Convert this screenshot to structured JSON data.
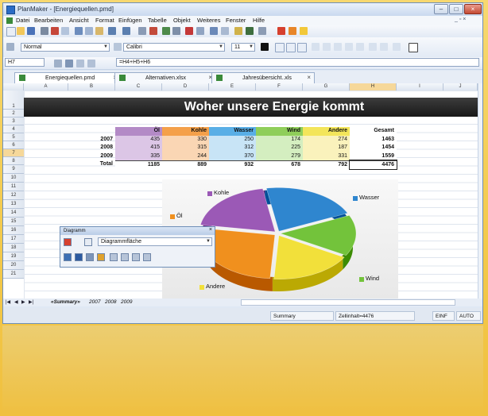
{
  "window": {
    "title": "PlanMaker - [Energiequellen.pmd]",
    "min": "–",
    "max": "□",
    "close": "×"
  },
  "menu": [
    "Datei",
    "Bearbeiten",
    "Ansicht",
    "Format",
    "Einfügen",
    "Tabelle",
    "Objekt",
    "Weiteres",
    "Fenster",
    "Hilfe"
  ],
  "mdi_controls": "_ ▫ ×",
  "format": {
    "style": "Normal",
    "font": "Calibri",
    "size": "11"
  },
  "formula_bar": {
    "cell_ref": "H7",
    "formula": "=H4+H5+H6"
  },
  "tabs": [
    {
      "label": "Energiequellen.pmd",
      "close": "×"
    },
    {
      "label": "Alternativen.xlsx",
      "close": "×"
    },
    {
      "label": "Jahresübersicht..xls",
      "close": "×"
    }
  ],
  "columns": [
    "A",
    "B",
    "C",
    "D",
    "E",
    "F",
    "G",
    "H",
    "I",
    "J"
  ],
  "rows": [
    "1",
    "2",
    "3",
    "4",
    "5",
    "6",
    "7",
    "8",
    "9",
    "10",
    "11",
    "12",
    "13",
    "14",
    "15",
    "16",
    "17",
    "18",
    "19",
    "20",
    "21"
  ],
  "banner": "Woher unsere Energie kommt",
  "table": {
    "headers": [
      "Öl",
      "Kohle",
      "Wasser",
      "Wind",
      "Andere",
      "Gesamt"
    ],
    "header_colors": [
      "#b38ac6",
      "#f4a04a",
      "#59aee6",
      "#8fce5a",
      "#f3e55a",
      "#ffffff"
    ],
    "body_colors": [
      "#dcc6e6",
      "#fad6b4",
      "#c8e4f6",
      "#d4eec0",
      "#faf2bc",
      "#ffffff"
    ],
    "rows": [
      {
        "label": "2007",
        "values": [
          "435",
          "330",
          "250",
          "174",
          "274",
          "1463"
        ]
      },
      {
        "label": "2008",
        "values": [
          "415",
          "315",
          "312",
          "225",
          "187",
          "1454"
        ]
      },
      {
        "label": "2009",
        "values": [
          "335",
          "244",
          "370",
          "279",
          "331",
          "1559"
        ]
      },
      {
        "label": "Total",
        "values": [
          "1185",
          "889",
          "932",
          "678",
          "792",
          "4476"
        ]
      }
    ]
  },
  "chart_data": {
    "type": "pie",
    "categories": [
      "Öl",
      "Kohle",
      "Wasser",
      "Wind",
      "Andere"
    ],
    "values": [
      1185,
      889,
      932,
      678,
      792
    ],
    "colors": [
      "#f0901e",
      "#9b59b6",
      "#2f86cf",
      "#73c33b",
      "#f2e03a"
    ]
  },
  "palette": {
    "title": "Diagramm",
    "close": "×",
    "select": "Diagrammfläche"
  },
  "sheet_tabs": [
    "«Summary»",
    "2007",
    "2008",
    "2009"
  ],
  "status": {
    "sheet": "Summary",
    "cell": "Zellinhalt=4476",
    "mode1": "EINF",
    "mode2": "AUTO"
  }
}
